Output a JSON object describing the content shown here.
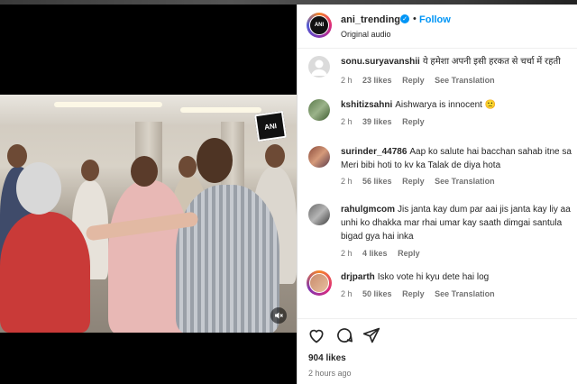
{
  "post": {
    "username": "ani_trending",
    "follow_label": "Follow",
    "separator": "•",
    "audio": "Original audio",
    "logo_text": "ANI",
    "likes": "904 likes",
    "time": "2 hours ago"
  },
  "comments": [
    {
      "user": "sonu.suryavanshii",
      "lines": [
        "ये हमेशा अपनी इसी हरकत से चर्चा में रहती"
      ],
      "age": "2 h",
      "likes": "23 likes",
      "reply": "Reply",
      "translate": "See Translation"
    },
    {
      "user": "kshitizsahni",
      "lines": [
        "Aishwarya is innocent 🙁"
      ],
      "age": "2 h",
      "likes": "39 likes",
      "reply": "Reply",
      "translate": ""
    },
    {
      "user": "surinder_44786",
      "lines": [
        "Aap ko salute hai bacchan sahab itne sa",
        "Meri bibi hoti to kv ka Talak de diya hota"
      ],
      "age": "2 h",
      "likes": "56 likes",
      "reply": "Reply",
      "translate": "See Translation"
    },
    {
      "user": "rahulgmcom",
      "lines": [
        "Jis janta kay dum par aai jis janta kay liy aa",
        "unhi ko dhakka mar rhai umar kay saath dimgai santula",
        "bigad gya hai inka"
      ],
      "age": "2 h",
      "likes": "4 likes",
      "reply": "Reply",
      "translate": ""
    },
    {
      "user": "drjparth",
      "lines": [
        "Isko vote hi kyu dete hai log"
      ],
      "age": "2 h",
      "likes": "50 likes",
      "reply": "Reply",
      "translate": "See Translation"
    }
  ],
  "icons": {
    "verified": "verified-badge-icon",
    "like": "heart-icon",
    "comment": "comment-icon",
    "share": "paper-plane-icon",
    "mute": "speaker-muted-icon"
  },
  "colors": {
    "link_blue": "#0095f6",
    "text": "#262626",
    "muted": "#737373"
  }
}
